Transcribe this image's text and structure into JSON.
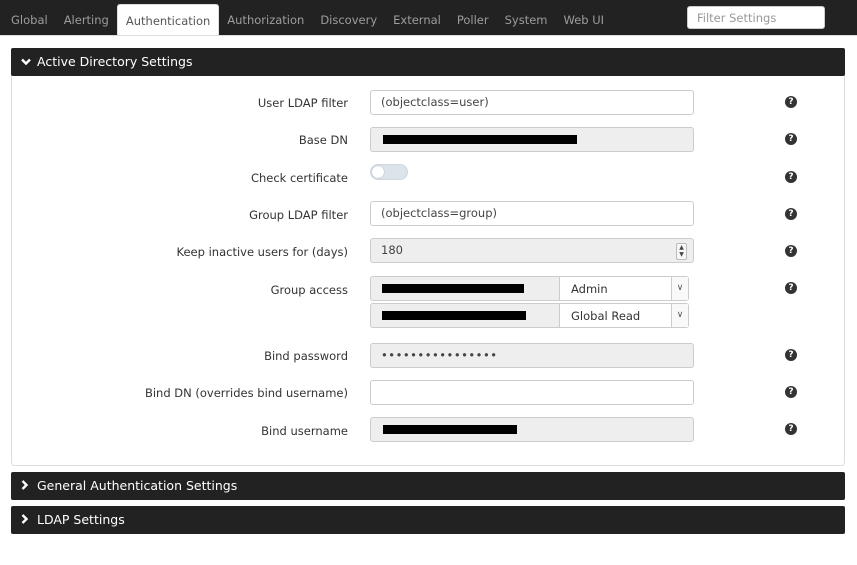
{
  "tabs": [
    {
      "label": "Global"
    },
    {
      "label": "Alerting"
    },
    {
      "label": "Authentication",
      "active": true
    },
    {
      "label": "Authorization"
    },
    {
      "label": "Discovery"
    },
    {
      "label": "External"
    },
    {
      "label": "Poller"
    },
    {
      "label": "System"
    },
    {
      "label": "Web UI"
    }
  ],
  "filter": {
    "placeholder": "Filter Settings"
  },
  "panels": {
    "ad": {
      "title": "Active Directory Settings"
    },
    "general": {
      "title": "General Authentication Settings"
    },
    "ldap": {
      "title": "LDAP Settings"
    }
  },
  "fields": {
    "user_ldap_filter": {
      "label": "User LDAP filter",
      "value": "(objectclass=user)"
    },
    "base_dn": {
      "label": "Base DN"
    },
    "check_certificate": {
      "label": "Check certificate",
      "enabled": false
    },
    "group_ldap_filter": {
      "label": "Group LDAP filter",
      "value": "(objectclass=group)"
    },
    "keep_inactive": {
      "label": "Keep inactive users for (days)",
      "value": "180"
    },
    "group_access": {
      "label": "Group access",
      "groups": [
        {
          "role": "Admin"
        },
        {
          "role": "Global Read"
        }
      ]
    },
    "bind_password": {
      "label": "Bind password",
      "value": "••••••••••••••••"
    },
    "bind_dn": {
      "label": "Bind DN (overrides bind username)",
      "value": ""
    },
    "bind_username": {
      "label": "Bind username"
    }
  },
  "icons": {
    "help": "question-circle-icon",
    "expanded": "chevron-down-icon",
    "collapsed": "chevron-right-icon"
  },
  "colors": {
    "header_bg": "#222222",
    "panel_head_bg": "#222222",
    "readonly_bg": "#eeeeee"
  }
}
